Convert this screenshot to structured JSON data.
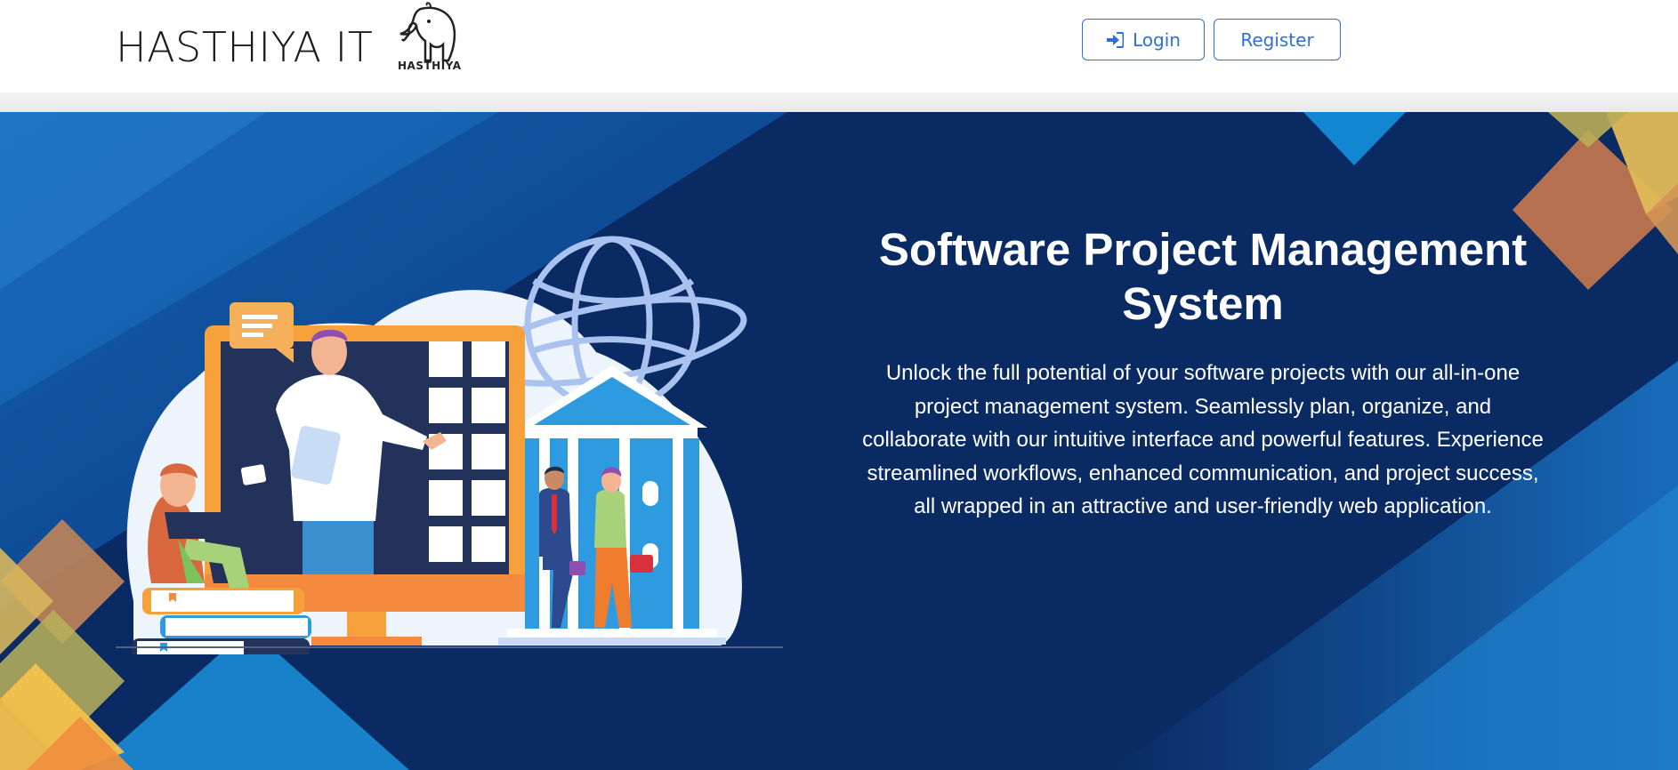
{
  "header": {
    "brand_name": "HASTHIYA IT",
    "logo_text": "HASTHIYA",
    "login_label": "Login",
    "register_label": "Register"
  },
  "hero": {
    "title": "Software Project Management System",
    "description": "Unlock the full potential of your software projects with our all-in-one project management system. Seamlessly plan, organize, and collaborate with our intuitive interface and powerful features. Experience streamlined workflows, enhanced communication, and project success, all wrapped in an attractive and user-friendly web application."
  },
  "colors": {
    "hero_bg": "#0a2a63",
    "accent_blue": "#2f6fdb",
    "orange": "#f39c3c",
    "yellow": "#f2c14e"
  },
  "icons": {
    "login": "sign-in-icon",
    "logo": "elephant-logo-icon"
  }
}
